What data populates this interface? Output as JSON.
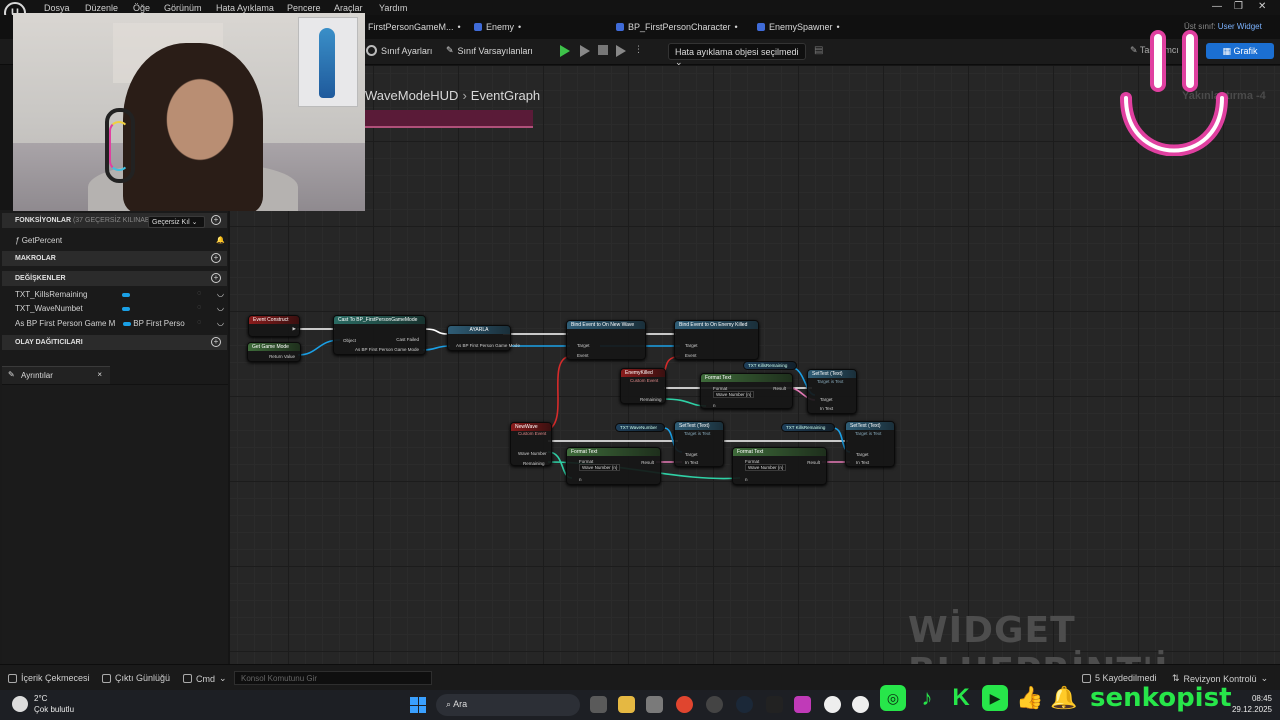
{
  "menu": [
    "Dosya",
    "Düzenle",
    "Öğe",
    "Görünüm",
    "Hata Ayıklama",
    "Pencere",
    "Araçlar",
    "Yardım"
  ],
  "tabs": [
    {
      "label": "FirstPersonGameM..."
    },
    {
      "label": "Enemy"
    },
    {
      "label": "BP_FirstPersonCharacter"
    },
    {
      "label": "EnemySpawner"
    }
  ],
  "parent_class": {
    "label": "Üst sınıf:",
    "value": "User Widget"
  },
  "toolbar": {
    "class_settings": "Sınıf Ayarları",
    "class_defaults": "Sınıf Varsayılanları",
    "debug_object": "Hata ayıklama objesi seçilmedi",
    "designer": "Tasarımcı",
    "graph": "Grafik"
  },
  "breadcrumb": {
    "widget": "WaveModeHUD",
    "graph": "EventGraph"
  },
  "zoom": "Yakınlaştırma -4",
  "left_panel": {
    "functions_header": "FONKSİYONLAR",
    "functions_sub": "(37 GEÇERSİZ KILINAB",
    "override_label": "Geçersiz Kıl",
    "functions": [
      "GetPercent"
    ],
    "macros_header": "MAKROLAR",
    "variables_header": "DEĞİŞKENLER",
    "variables": [
      {
        "name": "TXT_KillsRemaining",
        "type": ""
      },
      {
        "name": "TXT_WaveNumbet",
        "type": ""
      },
      {
        "name": "As BP First Person Game M",
        "type": "BP First Perso"
      }
    ],
    "dispatchers_header": "OLAY DAĞITICILARI",
    "details_tab": "Ayrıntılar"
  },
  "nodes": {
    "event_construct": {
      "title": "Event Construct"
    },
    "get_game_mode": {
      "title": "Get Game Mode",
      "pin_return": "Return Value"
    },
    "cast": {
      "title": "Cast To BP_FirstPersonGameMode",
      "pin_object": "Object",
      "pin_failed": "Cast Failed",
      "pin_as": "As BP First Person Game Mode"
    },
    "set_var": {
      "title": "AYARLA",
      "pin": "As BP First Person Game Mode"
    },
    "bind_new_wave": {
      "title": "Bind Event to On New Wave",
      "pin_target": "Target",
      "pin_event": "Event"
    },
    "bind_enemy_killed": {
      "title": "Bind Event to On Enemy Killed",
      "pin_target": "Target",
      "pin_event": "Event"
    },
    "enemy_killed_event": {
      "title": "EnemyKilled",
      "subtitle": "Custom Event",
      "pin": "Remaining"
    },
    "format_text_1": {
      "title": "Format Text",
      "pin_format": "Format",
      "format_value": "Wave Number {n}",
      "pin_result": "Result",
      "pin_n": "n"
    },
    "set_text_1": {
      "title": "SetText (Text)",
      "subtitle": "Target is Text",
      "pin_target": "Target",
      "pin_intext": "In Text"
    },
    "var_kills_1": {
      "title": "TXT KillsRemaining"
    },
    "new_wave_event": {
      "title": "NewWave",
      "subtitle": "Custom Event",
      "pin_wave": "Wave Number",
      "pin_remaining": "Remaining"
    },
    "var_wave": {
      "title": "TXT WaveNumber"
    },
    "set_text_2": {
      "title": "SetText (Text)",
      "subtitle": "Target is Text",
      "pin_target": "Target",
      "pin_intext": "In Text"
    },
    "format_text_2": {
      "title": "Format Text",
      "pin_format": "Format",
      "format_value": "Wave Number {n}",
      "pin_result": "Result",
      "pin_n": "n"
    },
    "var_kills_2": {
      "title": "TXT KillsRemaining"
    },
    "set_text_3": {
      "title": "SetText (Text)",
      "subtitle": "Target is Text",
      "pin_target": "Target",
      "pin_intext": "In Text"
    },
    "format_text_3": {
      "title": "Format Text",
      "pin_format": "Format",
      "format_value": "Wave Number {n}",
      "pin_result": "Result",
      "pin_n": "n"
    }
  },
  "watermark": "WİDGET BLUEPRİNT'İ",
  "statusbar": {
    "content_drawer": "İçerik Çekmecesi",
    "output_log": "Çıktı Günlüğü",
    "cmd": "Cmd",
    "console_placeholder": "Konsol Komutunu Gir",
    "saved": "5 Kaydedilmedi",
    "revision": "Revizyon Kontrolü"
  },
  "taskbar": {
    "temperature": "2°C",
    "weather": "Çok bulutlu",
    "search": "Ara",
    "time": "08:45",
    "date": "29.12.2025"
  },
  "socials": {
    "handle": "senkopist"
  }
}
